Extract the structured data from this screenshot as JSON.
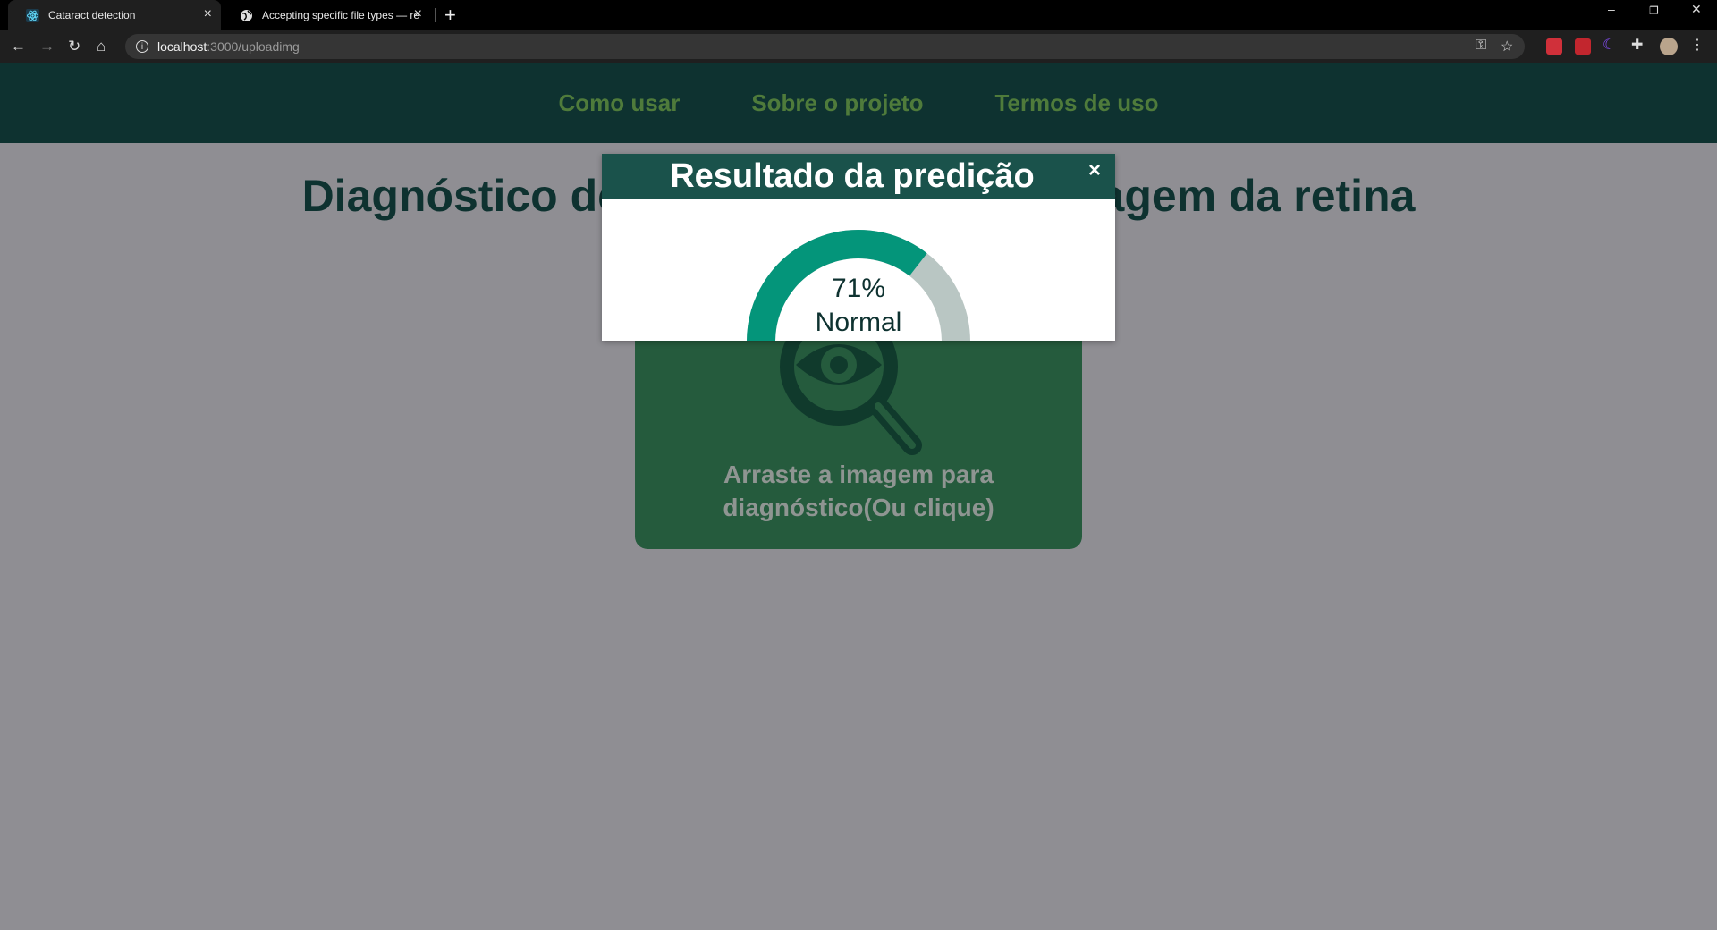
{
  "browser": {
    "tabs": [
      {
        "title": "Cataract detection",
        "active": true
      },
      {
        "title": "Accepting specific file types — re",
        "active": false
      }
    ],
    "new_tab": "+",
    "url": {
      "host": "localhost",
      "path": ":3000/uploadimg"
    },
    "window_controls": {
      "minimize": "–",
      "restore": "❐",
      "close": "✕"
    }
  },
  "navbar": {
    "links": [
      "Como usar",
      "Sobre o projeto",
      "Termos de uso"
    ]
  },
  "page": {
    "heading": "Diagnóstico de catarata a partir da imagem da retina",
    "upload_text": "Arraste a imagem para diagnóstico(Ou clique)"
  },
  "modal": {
    "title": "Resultado da predição",
    "close": "×",
    "gauge": {
      "value": 71,
      "percent_text": "71%",
      "label": "Normal",
      "fill_color": "#04957a",
      "track_color": "#b9c6c3"
    }
  },
  "colors": {
    "navbar_bg": "#0e3230",
    "nav_link": "#4f7b3b",
    "modal_header": "#1a524b",
    "upload_box": "#255b3d",
    "backdrop": "#8f8e93"
  }
}
